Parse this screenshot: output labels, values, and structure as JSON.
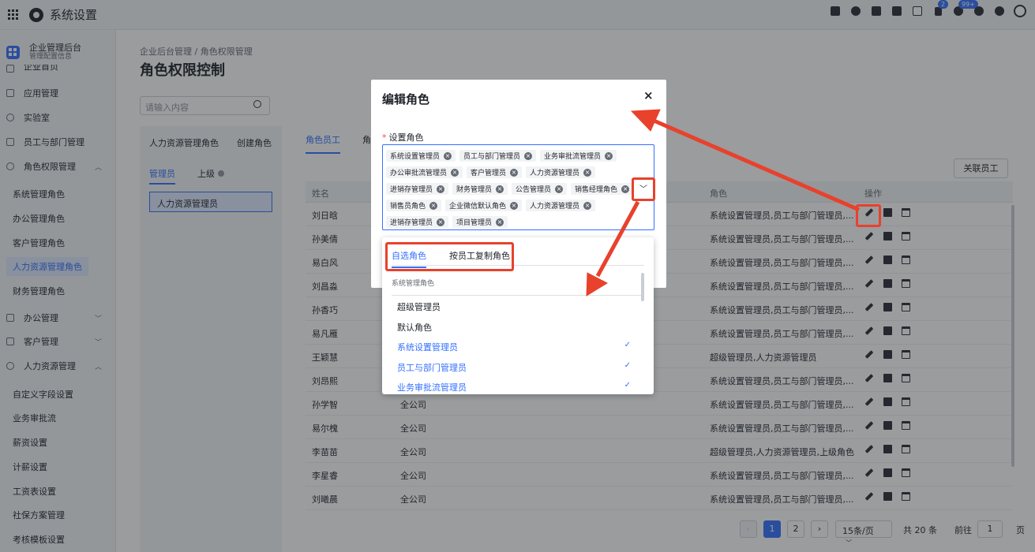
{
  "topbar": {
    "app_title": "系统设置",
    "icons": [
      "grid-icon",
      "logo-icon",
      "check-calendar-icon",
      "user-icon",
      "document-icon",
      "phone-icon",
      "calendar-icon",
      "flag-icon",
      "bell-icon",
      "help-icon",
      "gear-icon",
      "avatar-icon"
    ],
    "flag_badge": "2",
    "bell_badge": "99+"
  },
  "sidebar": {
    "head_title": "企业管理后台",
    "head_subtitle": "管理配置信息",
    "items": [
      {
        "label": "企业首页",
        "expanded": null
      },
      {
        "label": "应用管理",
        "expanded": null
      },
      {
        "label": "实验室",
        "expanded": null
      },
      {
        "label": "员工与部门管理",
        "expanded": null
      },
      {
        "label": "角色权限管理",
        "expanded": true
      },
      {
        "label": "办公管理",
        "expanded": false
      },
      {
        "label": "客户管理",
        "expanded": false
      },
      {
        "label": "人力资源管理",
        "expanded": true
      }
    ],
    "role_subs": [
      "系统管理角色",
      "办公管理角色",
      "客户管理角色",
      "人力资源管理角色",
      "财务管理角色"
    ],
    "hr_subs": [
      "自定义字段设置",
      "业务审批流",
      "薪资设置",
      "计薪设置",
      "工资表设置",
      "社保方案管理",
      "考核模板设置"
    ],
    "active": "人力资源管理角色"
  },
  "main": {
    "breadcrumb": "企业后台管理 / 角色权限管理",
    "title": "角色权限控制",
    "search_placeholder": "请输入内容",
    "left_tabs": [
      "人力资源管理角色",
      "创建角色"
    ],
    "left_sub_tabs": [
      "管理员",
      "上级"
    ],
    "left_selected_item": "人力资源管理员",
    "right_tabs": [
      "角色员工",
      "角"
    ],
    "related_button": "关联员工",
    "columns": [
      "姓名",
      "角色",
      "操作"
    ],
    "rows": [
      {
        "name": "刘日晗",
        "dept": "",
        "role": "系统设置管理员,员工与部门管理员,..."
      },
      {
        "name": "孙美倩",
        "dept": "",
        "role": "系统设置管理员,员工与部门管理员,..."
      },
      {
        "name": "易白风",
        "dept": "",
        "role": "系统设置管理员,员工与部门管理员,..."
      },
      {
        "name": "刘昌淼",
        "dept": "",
        "role": "系统设置管理员,员工与部门管理员,..."
      },
      {
        "name": "孙香巧",
        "dept": "",
        "role": "系统设置管理员,员工与部门管理员,..."
      },
      {
        "name": "易凡雁",
        "dept": "",
        "role": "系统设置管理员,员工与部门管理员,..."
      },
      {
        "name": "王颖慧",
        "dept": "",
        "role": "超级管理员,人力资源管理员"
      },
      {
        "name": "刘昂熙",
        "dept": "",
        "role": "系统设置管理员,员工与部门管理员,..."
      },
      {
        "name": "孙学智",
        "dept": "全公司",
        "role": "系统设置管理员,员工与部门管理员,..."
      },
      {
        "name": "易尔槐",
        "dept": "全公司",
        "role": "系统设置管理员,员工与部门管理员,..."
      },
      {
        "name": "李苗苗",
        "dept": "全公司",
        "role": "超级管理员,人力资源管理员,上级角色"
      },
      {
        "name": "李星睿",
        "dept": "全公司",
        "role": "系统设置管理员,员工与部门管理员,..."
      },
      {
        "name": "刘曦晨",
        "dept": "全公司",
        "role": "系统设置管理员,员工与部门管理员,..."
      }
    ],
    "pagination": {
      "pages": [
        "1",
        "2"
      ],
      "current": "1",
      "page_size": "15条/页",
      "total": "共 20 条",
      "goto_label": "前往",
      "goto_value": "1",
      "page_suffix": "页"
    }
  },
  "modal": {
    "title": "编辑角色",
    "close": "×",
    "field_label": "设置角色",
    "required_mark": "*",
    "tags": [
      "系统设置管理员",
      "员工与部门管理员",
      "业务审批流管理员",
      "办公审批流管理员",
      "客户管理员",
      "人力资源管理员",
      "进销存管理员",
      "财务管理员",
      "公告管理员",
      "销售经理角色",
      "销售员角色",
      "企业微信默认角色",
      "人力资源管理员",
      "进销存管理员",
      "项目管理员"
    ]
  },
  "dropdown": {
    "tabs": [
      "自选角色",
      "按员工复制角色"
    ],
    "group_label": "系统管理角色",
    "options": [
      {
        "label": "超级管理员",
        "selected": false
      },
      {
        "label": "默认角色",
        "selected": false
      },
      {
        "label": "系统设置管理员",
        "selected": true
      },
      {
        "label": "员工与部门管理员",
        "selected": true
      },
      {
        "label": "业务审批流管理员",
        "selected": true
      }
    ],
    "check": "✓"
  },
  "colors": {
    "accent": "#3370ff",
    "annotation": "#e8412c",
    "sidebar_bg": "#f5f6f8"
  }
}
